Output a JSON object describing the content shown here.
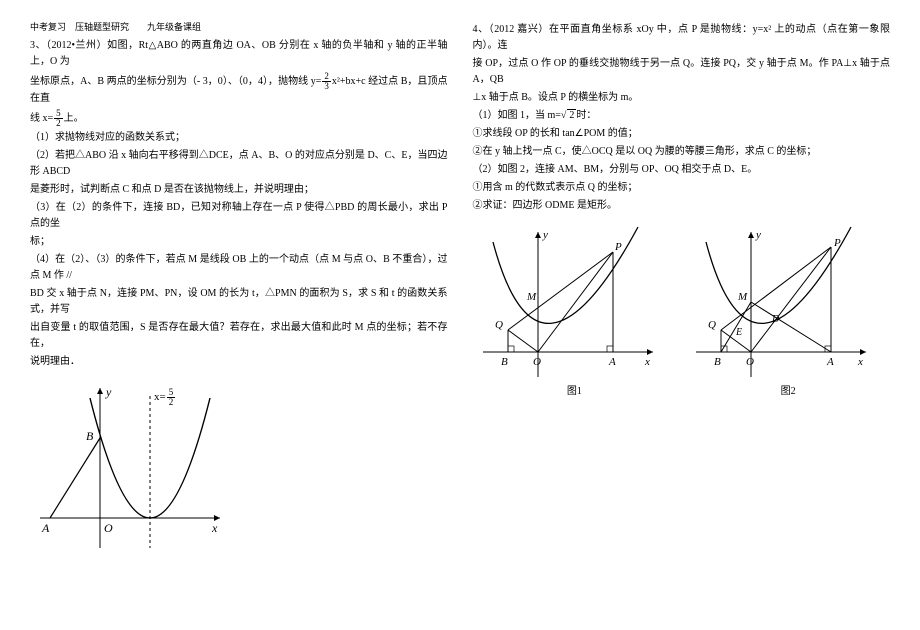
{
  "header": "中考复习　压轴题型研究　　九年级备课组",
  "left": {
    "p1a": "3、（2012•兰州）如图，Rt△ABO 的两直角边 OA、OB 分别在 x 轴的负半轴和 y 轴的正半轴上，O 为",
    "p1b": "坐标原点，A、B 两点的坐标分别为（- 3，0）、（0，4），抛物线 y=",
    "p1c": "x²+bx+c 经过点 B，且顶点在直",
    "p1d": "线 x=",
    "p1e": "上。",
    "q1": "（1）求抛物线对应的函数关系式；",
    "q2a": "（2）若把△ABO 沿 x 轴向右平移得到△DCE，点 A、B、O 的对应点分别是 D、C、E，当四边形 ABCD",
    "q2b": "是菱形时，试判断点 C 和点 D 是否在该抛物线上，并说明理由；",
    "q3a": "（3）在（2）的条件下，连接 BD，已知对称轴上存在一点 P 使得△PBD 的周长最小，求出 P 点的坐",
    "q3b": "标；",
    "q4a": "（4）在（2）、（3）的条件下，若点 M 是线段 OB 上的一个动点（点 M 与点 O、B 不重合），过点 M 作 //",
    "q4b": "BD 交 x 轴于点 N，连接 PM、PN，设 OM 的长为 t，△PMN 的面积为 S，求 S 和 t 的函数关系式，并写",
    "q4c": "出自变量 t 的取值范围，S 是否存在最大值？若存在，求出最大值和此时 M 点的坐标；若不存在，",
    "q4d": "说明理由．",
    "frac1_num": "2",
    "frac1_den": "3",
    "frac2_num": "5",
    "frac2_den": "2",
    "fig_xeq": "x=",
    "fig_frac_num": "5",
    "fig_frac_den": "2",
    "fig_y": "y",
    "fig_x": "x",
    "fig_A": "A",
    "fig_B": "B",
    "fig_O": "O"
  },
  "right": {
    "p1a": "4、（2012 嘉兴）在平面直角坐标系 xOy 中，点 P 是抛物线：y=x² 上的动点（点在第一象限内）。连",
    "p1b": "接 OP，过点 O 作 OP 的垂线交抛物线于另一点 Q。连接 PQ，交 y 轴于点 M。作 PA⊥x 轴于点 A，QB",
    "p1c": "⊥x 轴于点 B。设点 P 的横坐标为 m。",
    "q1a": "（1）如图 1，当 m=",
    "q1b": "时：",
    "q1_1": "①求线段 OP 的长和 tan∠POM 的值；",
    "q1_2": "②在 y 轴上找一点 C，使△OCQ 是以 OQ 为腰的等腰三角形，求点 C 的坐标；",
    "q2a": "（2）如图 2，连接 AM、BM，分别与 OP、OQ 相交于点 D、E。",
    "q2_1": "①用含 m 的代数式表示点 Q 的坐标；",
    "q2_2": "②求证：四边形 ODME 是矩形。",
    "sqrt2": "2",
    "fig1_label": "图1",
    "fig2_label": "图2",
    "fig_y": "y",
    "fig_x": "x",
    "fig_A": "A",
    "fig_B": "B",
    "fig_O": "O",
    "fig_M": "M",
    "fig_Q": "Q",
    "fig_P": "P",
    "fig_D": "D",
    "fig_E": "E"
  }
}
